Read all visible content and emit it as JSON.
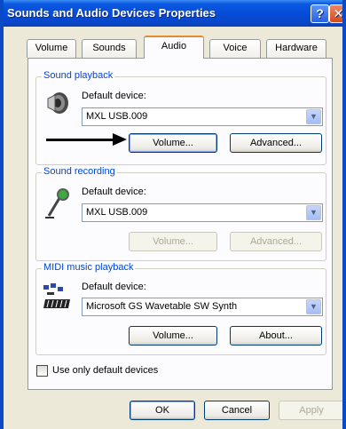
{
  "window": {
    "title": "Sounds and Audio Devices Properties",
    "help_glyph": "?",
    "close_glyph": "✕"
  },
  "tabs": [
    {
      "label": "Volume"
    },
    {
      "label": "Sounds"
    },
    {
      "label": "Audio",
      "active": true
    },
    {
      "label": "Voice"
    },
    {
      "label": "Hardware"
    }
  ],
  "playback": {
    "group_title": "Sound playback",
    "icon": "speaker-icon",
    "default_label": "Default device:",
    "device": "MXL USB.009",
    "volume_button": "Volume...",
    "advanced_button": "Advanced..."
  },
  "recording": {
    "group_title": "Sound recording",
    "icon": "microphone-icon",
    "default_label": "Default device:",
    "device": "MXL USB.009",
    "volume_button": "Volume...",
    "advanced_button": "Advanced..."
  },
  "midi": {
    "group_title": "MIDI music playback",
    "icon": "midi-keyboard-icon",
    "default_label": "Default device:",
    "device": "Microsoft GS Wavetable SW Synth",
    "volume_button": "Volume...",
    "about_button": "About..."
  },
  "options": {
    "use_default_only_label": "Use only default devices",
    "use_default_only_checked": false
  },
  "footer": {
    "ok": "OK",
    "cancel": "Cancel",
    "apply": "Apply"
  },
  "colors": {
    "titlebar": "#0549d6",
    "group_title": "#0046d5",
    "active_tab_accent": "#e68b2c"
  }
}
